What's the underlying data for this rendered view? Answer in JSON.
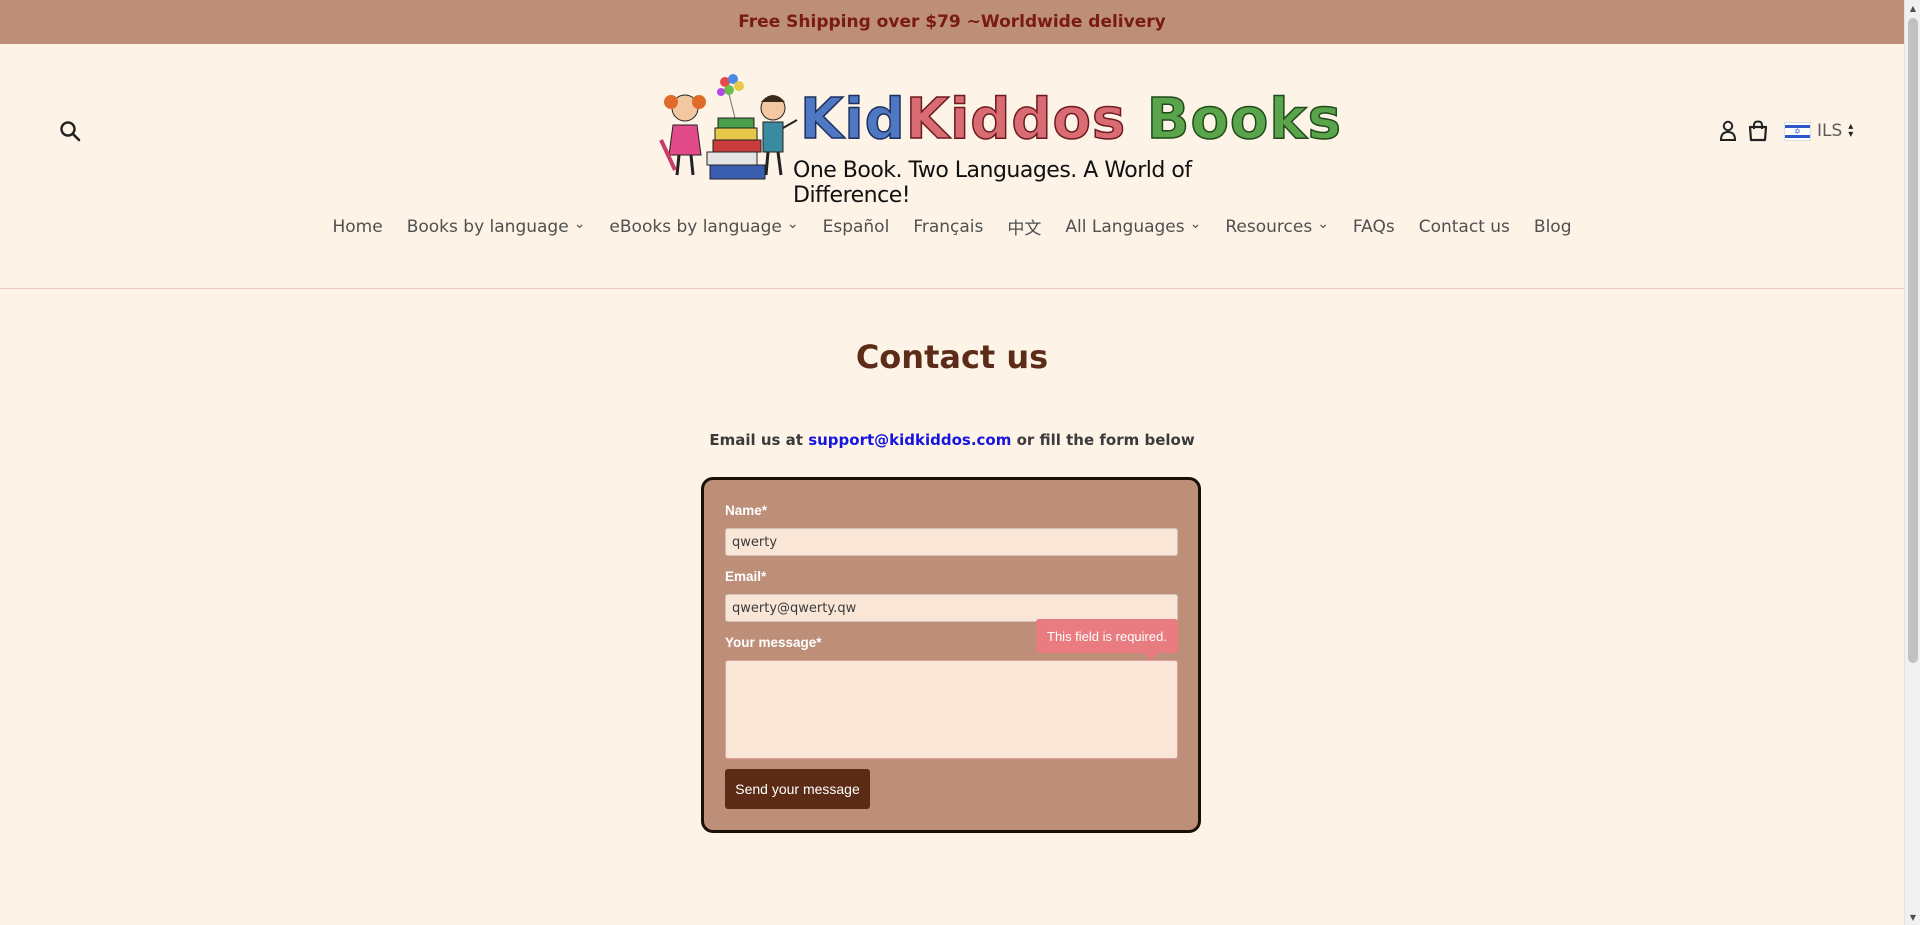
{
  "announcement": {
    "text": "Free Shipping over $79 ~Worldwide delivery"
  },
  "header": {
    "logo": {
      "brand_part_1": "Kid",
      "brand_part_2": "Kiddos",
      "brand_part_3": "Books",
      "tagline": "One Book. Two Languages. A World of Difference!"
    },
    "icons": {
      "search": "search-icon",
      "account": "account-icon",
      "cart": "cart-icon",
      "flag": "israel-flag-icon"
    },
    "currency": "ILS"
  },
  "nav": {
    "items": [
      {
        "label": "Home",
        "dropdown": false
      },
      {
        "label": "Books by language",
        "dropdown": true
      },
      {
        "label": "eBooks by language",
        "dropdown": true
      },
      {
        "label": "Español",
        "dropdown": false
      },
      {
        "label": "Français",
        "dropdown": false
      },
      {
        "label": "中文",
        "dropdown": false
      },
      {
        "label": "All Languages",
        "dropdown": true
      },
      {
        "label": "Resources",
        "dropdown": true
      },
      {
        "label": "FAQs",
        "dropdown": false
      },
      {
        "label": "Contact us",
        "dropdown": false
      },
      {
        "label": "Blog",
        "dropdown": false
      }
    ]
  },
  "page": {
    "title": "Contact us",
    "intro_prefix": "Email us at ",
    "intro_email": "support@kidkiddos.com",
    "intro_suffix": " or fill the form below"
  },
  "form": {
    "name_label": "Name*",
    "name_value": "qwerty",
    "email_label": "Email*",
    "email_value": "qwerty@qwerty.qw",
    "message_label": "Your message*",
    "message_value": "",
    "submit_label": "Send your message",
    "error_tooltip": "This field is required."
  },
  "colors": {
    "announcement_bg": "#bd8e78",
    "announcement_text": "#7a1b12",
    "page_bg": "#fdf3e6",
    "title": "#5c2c18",
    "link": "#1515e0",
    "form_bg": "#bd8e78",
    "button_bg": "#5b2b16",
    "error_bg": "#e97c80"
  }
}
